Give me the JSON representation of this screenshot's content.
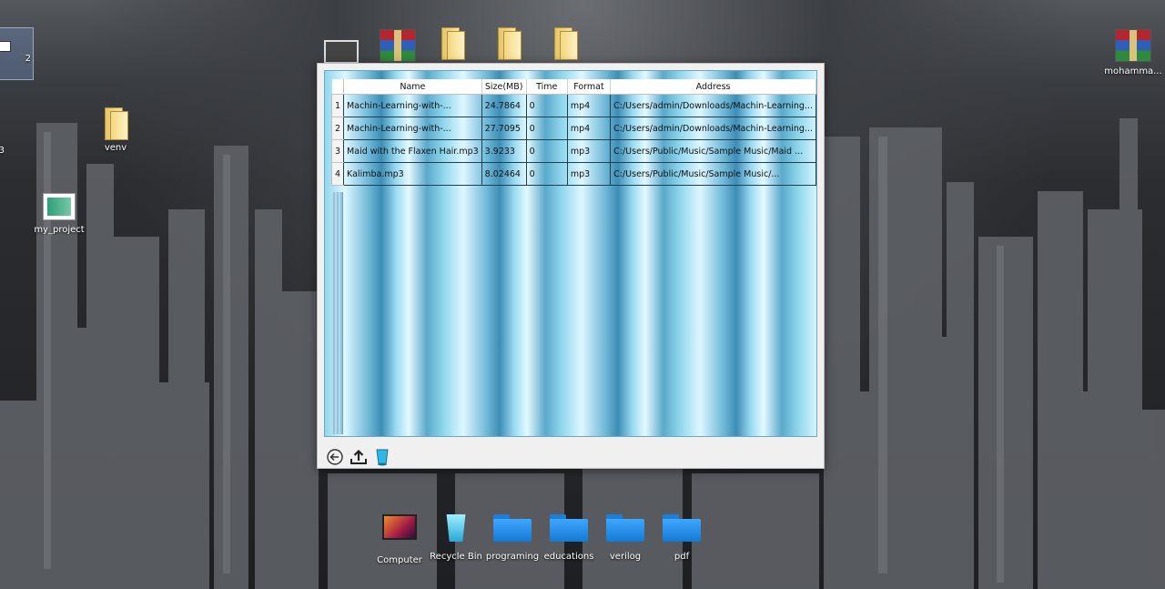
{
  "desktop": {
    "icons_left": [
      {
        "label": "2"
      },
      {
        "label": "venv"
      },
      {
        "label": "my_project"
      },
      {
        "label": "3"
      }
    ],
    "icon_top_right": {
      "label": "mohamma..."
    },
    "taskbar_icons": [
      {
        "label": "Computer"
      },
      {
        "label": "Recycle Bin"
      },
      {
        "label": "programing"
      },
      {
        "label": "educations"
      },
      {
        "label": "verilog"
      },
      {
        "label": "pdf"
      }
    ]
  },
  "table": {
    "columns": [
      "Name",
      "Size(MB)",
      "Time",
      "Format",
      "Address"
    ],
    "rows": [
      {
        "num": "1",
        "name": "Machin-Learning-with-...",
        "size": "24.7864",
        "time": "0",
        "format": "mp4",
        "address": "C:/Users/admin/Downloads/Machin-Learning..."
      },
      {
        "num": "2",
        "name": "Machin-Learning-with-...",
        "size": "27.7095",
        "time": "0",
        "format": "mp4",
        "address": "C:/Users/admin/Downloads/Machin-Learning..."
      },
      {
        "num": "3",
        "name": "Maid with the Flaxen Hair.mp3",
        "size": "3.9233",
        "time": "0",
        "format": "mp3",
        "address": "C:/Users/Public/Music/Sample Music/Maid ..."
      },
      {
        "num": "4",
        "name": "Kalimba.mp3",
        "size": "8.02464",
        "time": "0",
        "format": "mp3",
        "address": "C:/Users/Public/Music/Sample Music/..."
      }
    ]
  },
  "toolbar": {
    "icons": [
      "back-arrow-icon",
      "upload-icon",
      "recycle-bin-icon"
    ]
  },
  "colors": {
    "table_light": "#def7ff",
    "table_mid": "#8fd6ec",
    "table_dark": "#3d8db6",
    "grid_line": "#1f3f52"
  }
}
